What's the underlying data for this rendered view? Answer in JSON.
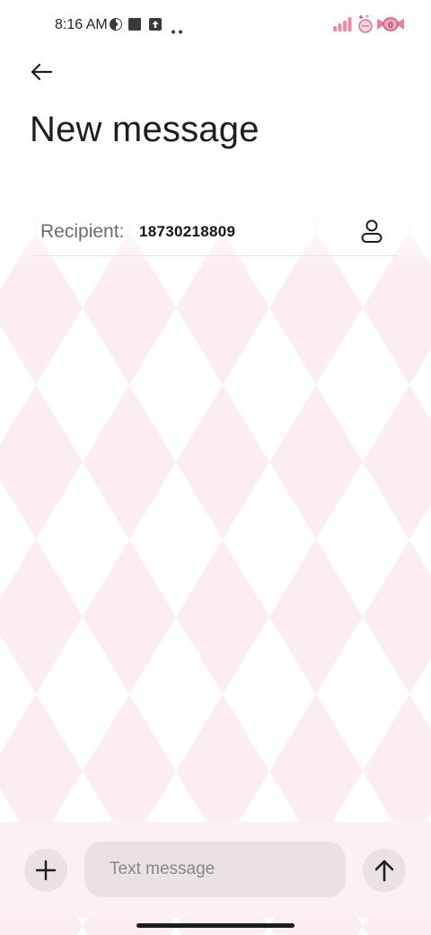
{
  "status_bar": {
    "time": "8:16 AM",
    "icons": [
      "theme-icon",
      "square-notification-icon",
      "upload-arrow-icon",
      "more-dots-icon",
      "sticker-bars-icon",
      "sticker-candy-icon",
      "sticker-ribbon-icon"
    ]
  },
  "header": {
    "back_icon": "arrow-left-icon",
    "title": "New message"
  },
  "recipient": {
    "label": "Recipient:",
    "value": "18730218809",
    "contact_icon": "person-icon"
  },
  "compose": {
    "add_icon": "plus-icon",
    "placeholder": "Text message",
    "value": "",
    "send_icon": "arrow-up-icon"
  },
  "theme": {
    "background": "#ffffff",
    "pattern_pink": "#fcedf2",
    "compose_background": "#fbf0f4",
    "button_fill": "#e9e1e4"
  }
}
